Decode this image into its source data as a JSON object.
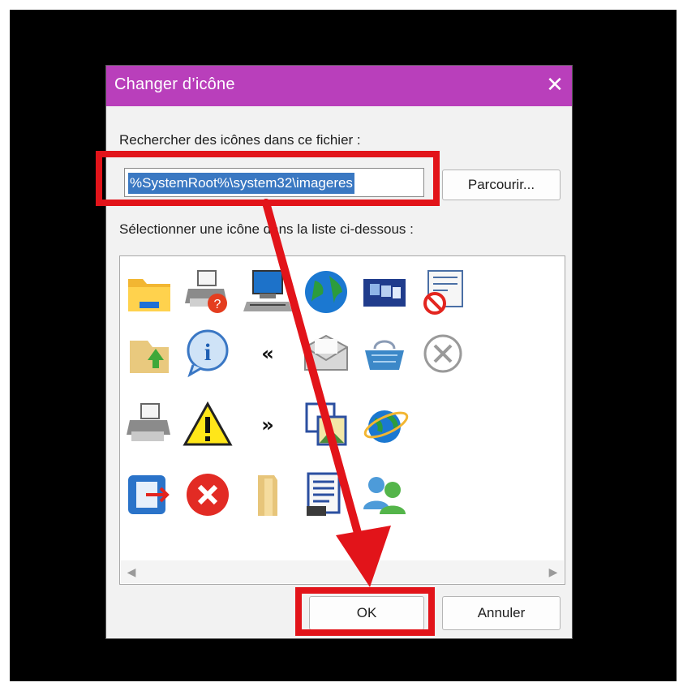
{
  "dialog": {
    "title": "Changer d’icône",
    "close_glyph": "✕",
    "search_label": "Rechercher des icônes dans ce fichier :",
    "path_value": "%SystemRoot%\\system32\\imageres",
    "browse_label": "Parcourir...",
    "select_label": "Sélectionner une icône dans la liste ci-dessous :",
    "ok_label": "OK",
    "cancel_label": "Annuler"
  },
  "icons": [
    [
      "folder-icon",
      "printer-help-icon",
      "computer-icon",
      "globe-icon",
      "windows-stack-icon",
      "blocked-document-icon"
    ],
    [
      "folder-green-arrow-icon",
      "info-icon",
      "double-left-arrow-icon",
      "mail-envelope-icon",
      "shopping-basket-icon",
      "close-circle-icon"
    ],
    [
      "printer-icon",
      "warning-icon",
      "double-right-arrow-icon",
      "image-frame-icon",
      "internet-globe-icon"
    ],
    [
      "exit-icon",
      "error-icon",
      "folder-closed-icon",
      "document-list-icon",
      "users-icon"
    ]
  ],
  "colors": {
    "titlebar": "#b93fbb",
    "selection": "#3a78c2",
    "annotation": "#e2141a"
  }
}
